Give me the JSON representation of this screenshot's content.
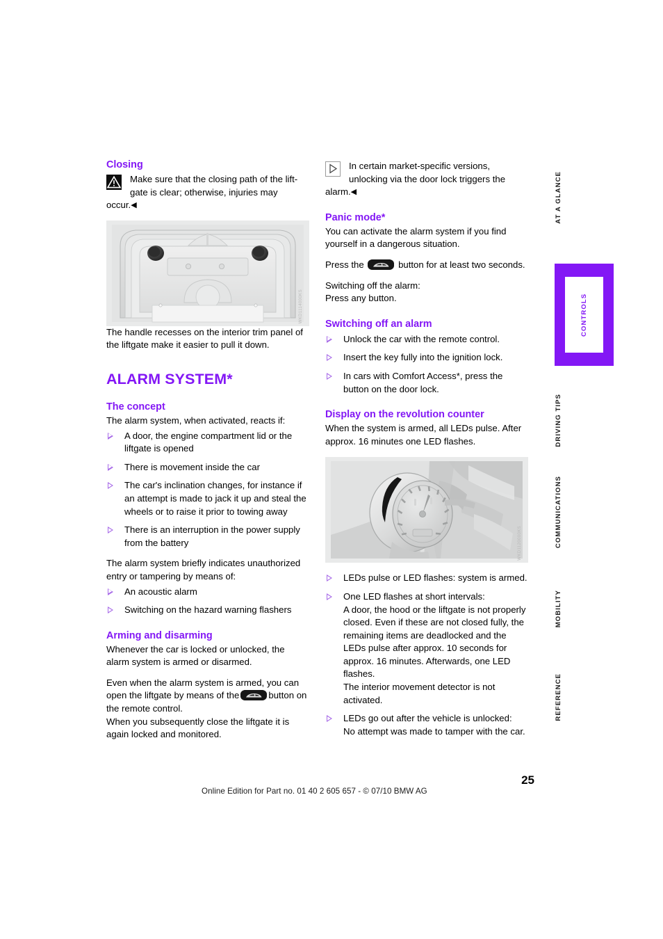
{
  "page": {
    "number": "25",
    "footer": "Online Edition for Part no. 01 40 2 605 657 - © 07/10  BMW AG"
  },
  "rail": {
    "items": [
      {
        "label": "AT A GLANCE",
        "active": false
      },
      {
        "label": "CONTROLS",
        "active": true
      },
      {
        "label": "DRIVING TIPS",
        "active": false
      },
      {
        "label": "COMMUNICATIONS",
        "active": false
      },
      {
        "label": "MOBILITY",
        "active": false
      },
      {
        "label": "REFERENCE",
        "active": false
      }
    ],
    "accent_color": "#8317F5"
  },
  "left_column": {
    "closing": {
      "heading": "Closing",
      "warning_text": "Make sure that the closing path of the lift-gate is clear; otherwise, injuries may",
      "warning_tail": "occur.",
      "end_mark": "◀"
    },
    "figure_liftgate": {
      "code": "WKD1114000KS",
      "caption": "The handle recesses on the interior trim panel of the liftgate make it easier to pull it down."
    },
    "alarm_system": {
      "title": "ALARM SYSTEM*",
      "concept": {
        "heading": "The concept",
        "intro": "The alarm system, when activated, reacts if:",
        "bullets": [
          "A door, the engine compartment lid or the liftgate is opened",
          "There is movement inside the car",
          "The car's inclination changes, for instance if an attempt is made to jack it up and steal the wheels or to raise it prior to towing away",
          "There is an interruption in the power supply from the battery"
        ],
        "outro": "The alarm system briefly indicates unauthorized entry or tampering by means of:",
        "bullets2": [
          "An acoustic alarm",
          "Switching on the hazard warning flashers"
        ]
      },
      "arming": {
        "heading": "Arming and disarming",
        "para1": "Whenever the car is locked or unlocked, the alarm system is armed or disarmed.",
        "para2_before": "Even when the alarm system is armed, you can open the liftgate by means of the",
        "para2_after": "button on the remote control.",
        "para3": "When you subsequently close the liftgate it is again locked and monitored."
      }
    }
  },
  "right_column": {
    "note": {
      "text": "In certain market-specific versions, unlocking via the door lock triggers the",
      "tail": "alarm.",
      "end_mark": "◀"
    },
    "panic_mode": {
      "heading": "Panic mode*",
      "para1": "You can activate the alarm system if you find yourself in a dangerous situation.",
      "press_before": "Press the",
      "press_after": "button for at least two seconds.",
      "para3": "Switching off the alarm:",
      "para4": "Press any button."
    },
    "switching_off": {
      "heading": "Switching off an alarm",
      "bullets": [
        "Unlock the car with the remote control.",
        "Insert the key fully into the ignition lock.",
        "In cars with Comfort Access*, press the button on the door lock."
      ]
    },
    "revolution_counter": {
      "heading": "Display on the revolution counter",
      "intro": "When the system is armed, all LEDs pulse. After approx. 16 minutes one LED flashes.",
      "figure_code": "WKD1120000KS",
      "bullets": [
        "LEDs pulse or LED flashes: system is armed.",
        "One LED flashes at short intervals:\nA door, the hood or the liftgate is not properly closed. Even if these are not closed fully, the remaining items are deadlocked and the LEDs pulse after approx. 10 seconds for approx. 16 minutes. Afterwards, one LED flashes.\nThe interior movement detector is not activated.",
        "LEDs go out after the vehicle is unlocked:\nNo attempt was made to tamper with the car."
      ]
    }
  }
}
